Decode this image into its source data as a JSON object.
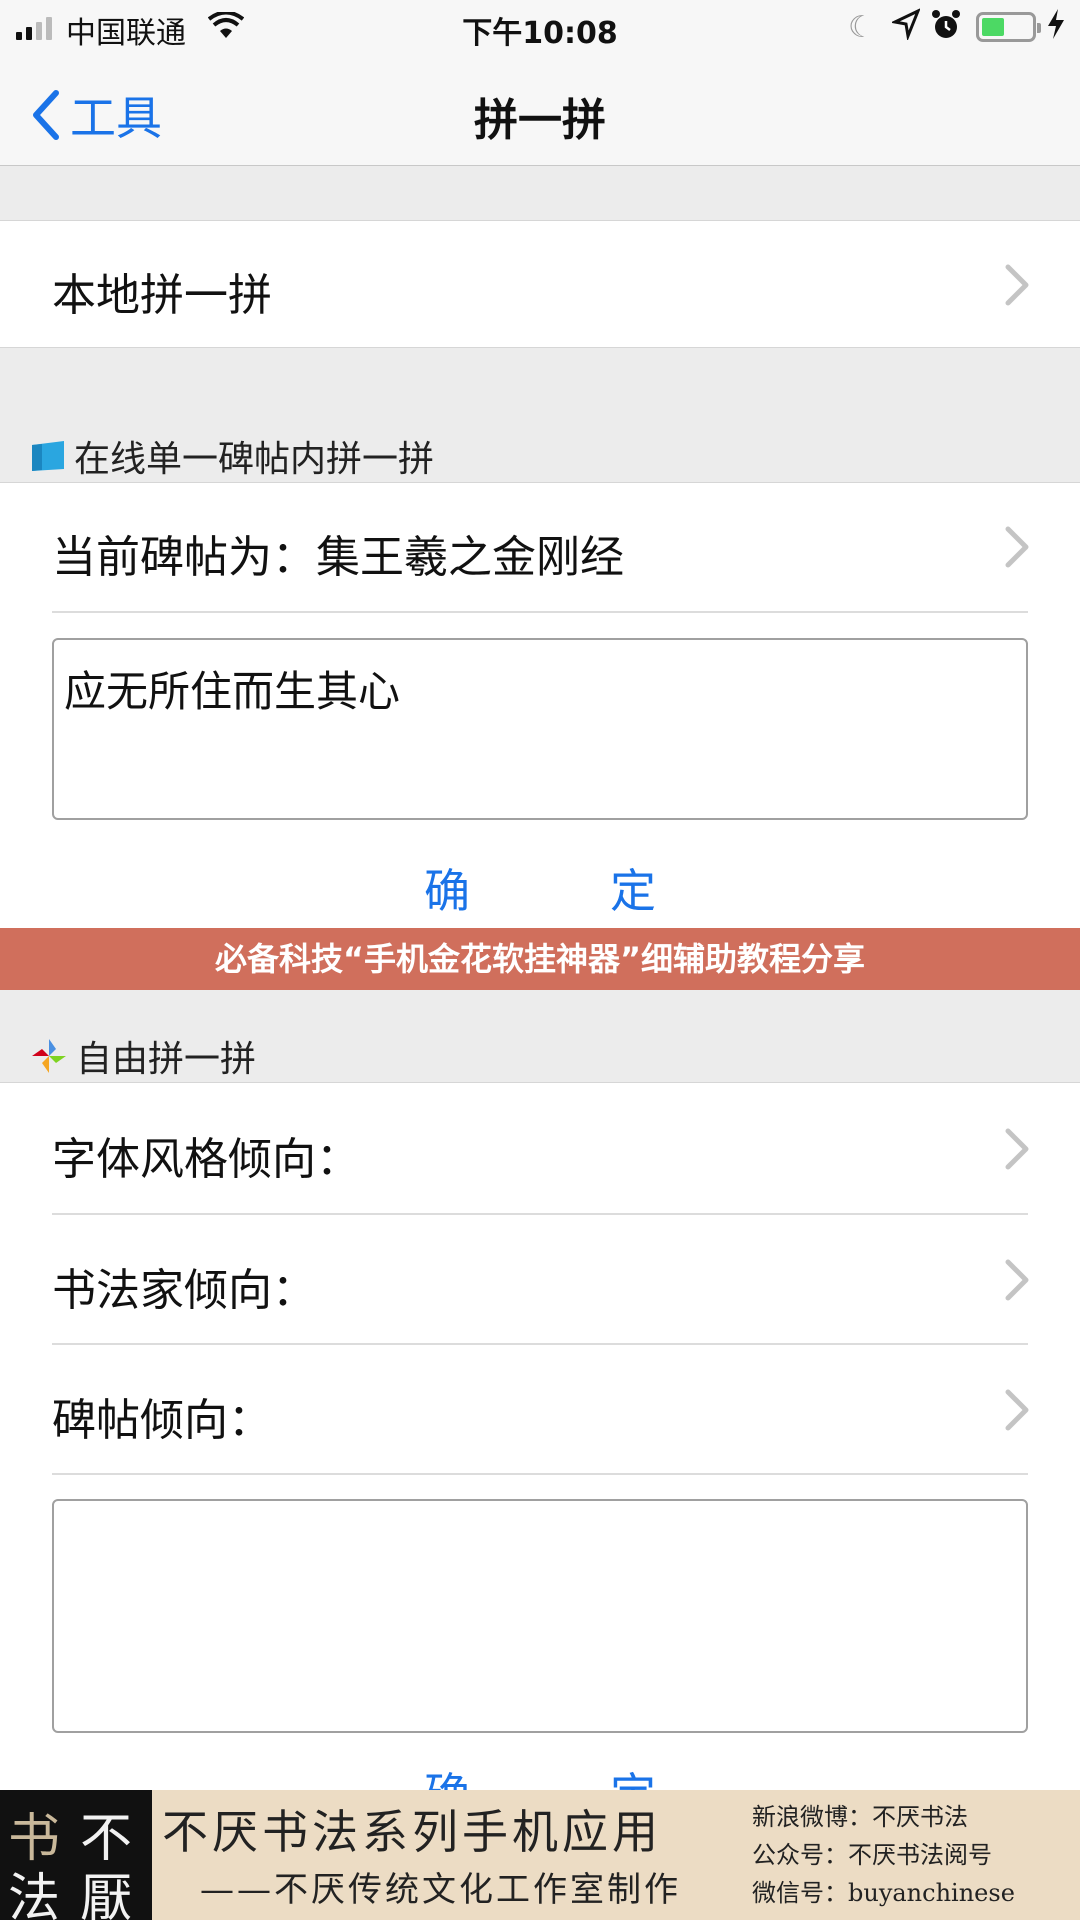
{
  "status": {
    "carrier": "中国联通",
    "time": "下午10:08"
  },
  "nav": {
    "back_label": "工具",
    "title": "拼一拼"
  },
  "local": {
    "label": "本地拼一拼"
  },
  "online": {
    "header": "在线单一碑帖内拼一拼",
    "current_label": "当前碑帖为：集王羲之金刚经",
    "input_value": "应无所住而生其心",
    "confirm_label": "确定"
  },
  "banner": {
    "text": "必备科技“手机金花软挂神器”细辅助教程分享"
  },
  "free": {
    "header": "自由拼一拼",
    "items": [
      {
        "label": "字体风格倾向："
      },
      {
        "label": "书法家倾向："
      },
      {
        "label": "碑帖倾向："
      }
    ],
    "input_value": "",
    "confirm_label": "确定"
  },
  "ad": {
    "logo_chars": [
      "书",
      "不",
      "法",
      "厭"
    ],
    "line1": "不厌书法系列手机应用",
    "line2": "——不厌传统文化工作室制作",
    "weibo": "新浪微博：不厌书法",
    "gongzhong": "公众号：不厌书法阅号",
    "weixin": "微信号：buyanchinese"
  },
  "colors": {
    "accent": "#1a73e8",
    "banner": "#d06f5c",
    "battery": "#4cd964"
  }
}
